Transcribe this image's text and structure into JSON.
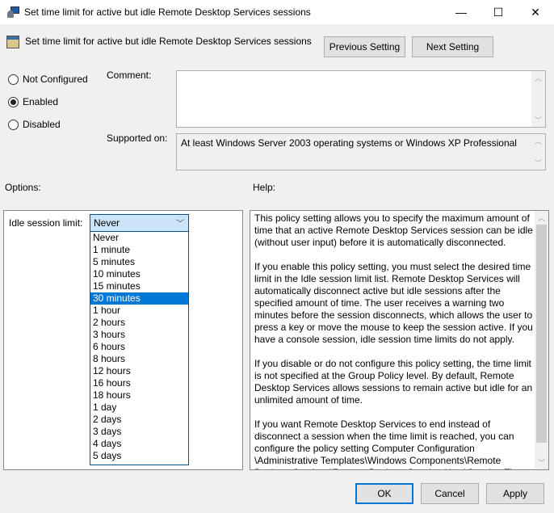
{
  "window": {
    "title": "Set time limit for active but idle Remote Desktop Services sessions",
    "controls": {
      "minimize": "—",
      "maximize": "☐",
      "close": "✕"
    }
  },
  "header": {
    "title": "Set time limit for active but idle Remote Desktop Services sessions",
    "previous_label": "Previous Setting",
    "next_label": "Next Setting"
  },
  "state": {
    "options": [
      "Not Configured",
      "Enabled",
      "Disabled"
    ],
    "selected": "Enabled"
  },
  "comment": {
    "label": "Comment:",
    "value": ""
  },
  "supported": {
    "label": "Supported on:",
    "value": "At least Windows Server 2003 operating systems or Windows XP Professional"
  },
  "options_label": "Options:",
  "help_label": "Help:",
  "idle": {
    "label": "Idle session limit:",
    "value": "Never",
    "list": [
      "Never",
      "1 minute",
      "5 minutes",
      "10 minutes",
      "15 minutes",
      "30 minutes",
      "1 hour",
      "2 hours",
      "3 hours",
      "6 hours",
      "8 hours",
      "12 hours",
      "16 hours",
      "18 hours",
      "1 day",
      "2 days",
      "3 days",
      "4 days",
      "5 days"
    ],
    "highlighted": "30 minutes"
  },
  "help": {
    "paragraphs": [
      "This policy setting allows you to specify the maximum amount of time that an active Remote Desktop Services session can be idle (without user input) before it is automatically disconnected.",
      "If you enable this policy setting, you must select the desired time limit in the Idle session limit list. Remote Desktop Services will automatically disconnect active but idle sessions after the specified amount of time. The user receives a warning two minutes before the session disconnects, which allows the user to press a key or move the mouse to keep the session active. If you have a console session, idle session time limits do not apply.",
      "If you disable or do not configure this policy setting, the time limit is not specified at the Group Policy level. By default, Remote Desktop Services allows sessions to remain active but idle for an unlimited amount of time.",
      "If you want Remote Desktop Services to end instead of disconnect a session when the time limit is reached, you can configure the policy setting Computer Configuration \\Administrative Templates\\Windows Components\\Remote Desktop Services\\Remote Desktop Session Host\\Session Time Limits. The"
    ]
  },
  "footer": {
    "ok": "OK",
    "cancel": "Cancel",
    "apply": "Apply"
  }
}
